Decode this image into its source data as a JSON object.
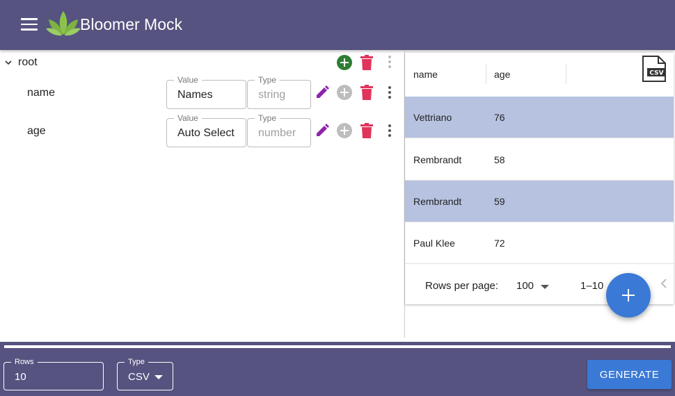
{
  "app": {
    "title": "Bloomer Mock"
  },
  "tree": {
    "root_label": "root",
    "fields": [
      {
        "name": "name",
        "value_label": "Value",
        "value": "Names",
        "type_label": "Type",
        "type": "string"
      },
      {
        "name": "age",
        "value_label": "Value",
        "value": "Auto Select",
        "type_label": "Type",
        "type": "number"
      }
    ]
  },
  "table": {
    "columns": [
      "name",
      "age"
    ],
    "rows": [
      {
        "name": "Vettriano",
        "age": "76",
        "selected": true
      },
      {
        "name": "Rembrandt",
        "age": "58",
        "selected": false
      },
      {
        "name": "Rembrandt",
        "age": "59",
        "selected": true
      },
      {
        "name": "Paul Klee",
        "age": "72",
        "selected": false
      }
    ],
    "csv_icon_text": "CSV",
    "footer": {
      "rows_per_page_label": "Rows per page:",
      "rows_per_page": "100",
      "range": "1–10"
    }
  },
  "bottom": {
    "rows_label": "Rows",
    "rows_value": "10",
    "type_label": "Type",
    "type_value": "CSV",
    "generate_label": "GENERATE"
  },
  "colors": {
    "appbar": "#565380",
    "primary": "#3a79d6",
    "add_green": "#2e7d32",
    "delete_red": "#e0345a",
    "edit_purple": "#8e24aa",
    "selected_row": "#b7c2e0"
  },
  "icons": [
    "menu-icon",
    "leaf-logo-icon",
    "chevron-down-icon",
    "add-circle-icon",
    "delete-icon",
    "more-vert-icon",
    "edit-icon",
    "csv-file-icon",
    "add-icon",
    "chevron-left-icon",
    "arrow-drop-down-icon"
  ]
}
